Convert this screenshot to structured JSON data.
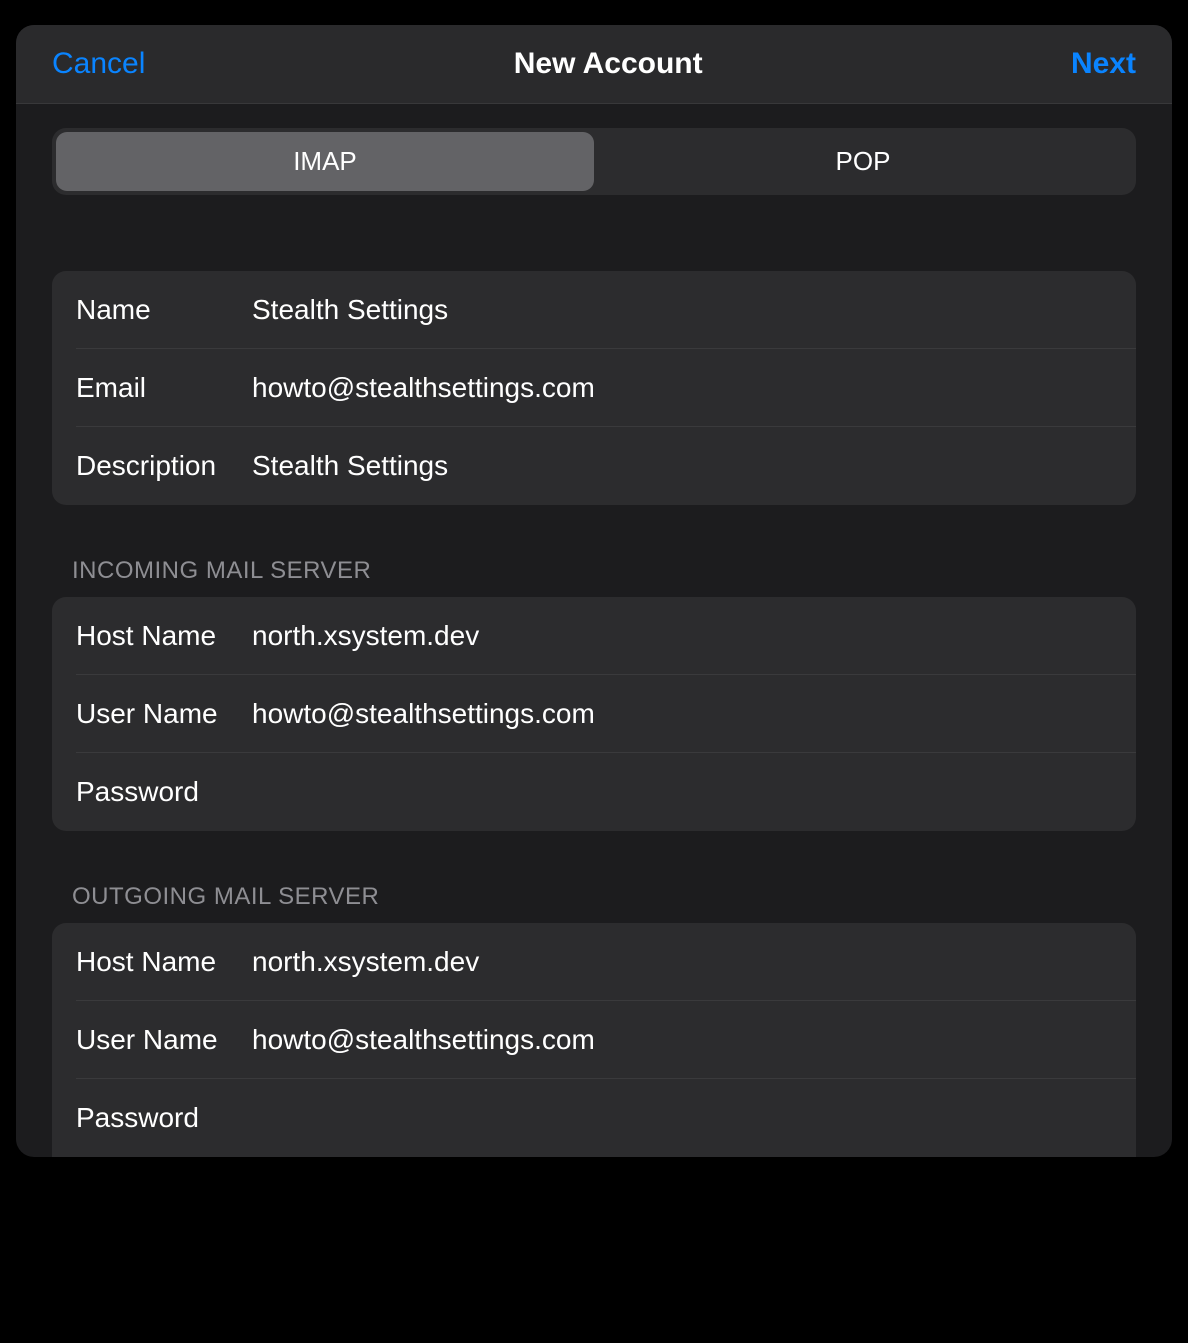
{
  "header": {
    "cancel": "Cancel",
    "title": "New Account",
    "next": "Next"
  },
  "segmented": {
    "imap": "IMAP",
    "pop": "POP"
  },
  "account": {
    "name_label": "Name",
    "name_value": "Stealth Settings",
    "email_label": "Email",
    "email_value": "howto@stealthsettings.com",
    "description_label": "Description",
    "description_value": "Stealth Settings"
  },
  "incoming": {
    "section": "Incoming Mail Server",
    "host_label": "Host Name",
    "host_value": "north.xsystem.dev",
    "user_label": "User Name",
    "user_value": "howto@stealthsettings.com",
    "password_label": "Password",
    "password_value": ""
  },
  "outgoing": {
    "section": "Outgoing Mail Server",
    "host_label": "Host Name",
    "host_value": "north.xsystem.dev",
    "user_label": "User Name",
    "user_value": "howto@stealthsettings.com",
    "password_label": "Password",
    "password_value": ""
  }
}
